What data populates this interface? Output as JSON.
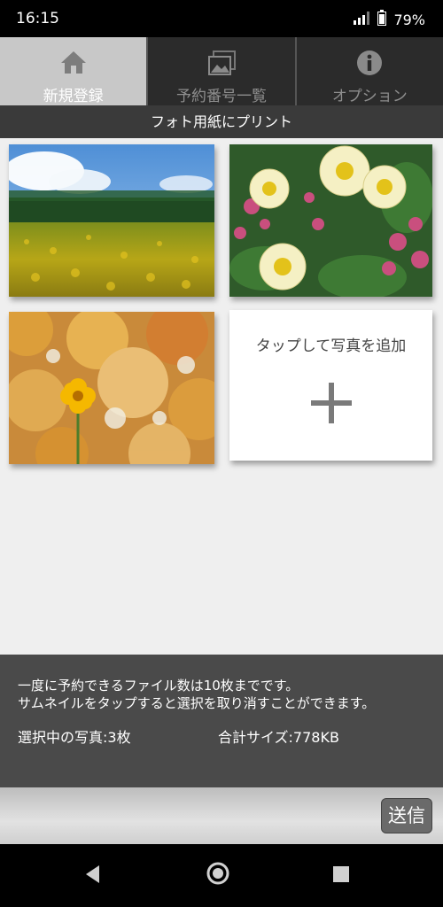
{
  "status": {
    "time": "16:15",
    "battery": "79%"
  },
  "tabs": [
    {
      "label": "新規登録",
      "icon": "home-icon",
      "active": true
    },
    {
      "label": "予約番号一覧",
      "icon": "gallery-icon",
      "active": false
    },
    {
      "label": "オプション",
      "icon": "info-icon",
      "active": false
    }
  ],
  "subheader": "フォト用紙にプリント",
  "photos": [
    {
      "desc": "sunflower field photo"
    },
    {
      "desc": "white flowers photo"
    },
    {
      "desc": "yellow flower photo"
    }
  ],
  "add_tile": {
    "label": "タップして写真を追加"
  },
  "info": {
    "line1": "一度に予約できるファイル数は10枚までです。",
    "line2": "サムネイルをタップすると選択を取り消すことができます。",
    "selected": "選択中の写真:3枚",
    "total_size": "合計サイズ:778KB"
  },
  "send_label": "送信"
}
